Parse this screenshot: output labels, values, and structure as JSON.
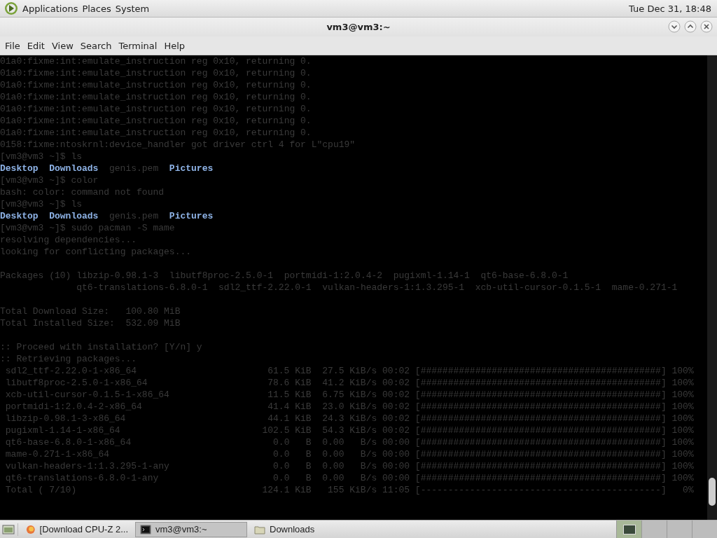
{
  "top_panel": {
    "menus": [
      {
        "label": "Applications"
      },
      {
        "label": "Places"
      },
      {
        "label": "System"
      }
    ],
    "clock": "Tue Dec 31, 18:48"
  },
  "window": {
    "title": "vm3@vm3:~"
  },
  "menu_bar": [
    {
      "label": "File"
    },
    {
      "label": "Edit"
    },
    {
      "label": "View"
    },
    {
      "label": "Search"
    },
    {
      "label": "Terminal"
    },
    {
      "label": "Help"
    }
  ],
  "terminal": {
    "lines": [
      {
        "kind": "text",
        "text": "01a0:fixme:int:emulate_instruction reg 0x10, returning 0."
      },
      {
        "kind": "text",
        "text": "01a0:fixme:int:emulate_instruction reg 0x10, returning 0."
      },
      {
        "kind": "text",
        "text": "01a0:fixme:int:emulate_instruction reg 0x10, returning 0."
      },
      {
        "kind": "text",
        "text": "01a0:fixme:int:emulate_instruction reg 0x10, returning 0."
      },
      {
        "kind": "text",
        "text": "01a0:fixme:int:emulate_instruction reg 0x10, returning 0."
      },
      {
        "kind": "text",
        "text": "01a0:fixme:int:emulate_instruction reg 0x10, returning 0."
      },
      {
        "kind": "text",
        "text": "01a0:fixme:int:emulate_instruction reg 0x10, returning 0."
      },
      {
        "kind": "text",
        "text": "0158:fixme:ntoskrnl:device_handler got driver ctrl 4 for L\"cpu19\""
      },
      {
        "kind": "text",
        "text": "[vm3@vm3 ~]$ ls"
      },
      {
        "kind": "ls",
        "entries": [
          {
            "text": "Desktop",
            "kind": "dir"
          },
          {
            "text": "Downloads",
            "kind": "dir"
          },
          {
            "text": "genis.pem",
            "kind": "file"
          },
          {
            "text": "Pictures",
            "kind": "dir"
          }
        ]
      },
      {
        "kind": "text",
        "text": "[vm3@vm3 ~]$ color"
      },
      {
        "kind": "text",
        "text": "bash: color: command not found"
      },
      {
        "kind": "text",
        "text": "[vm3@vm3 ~]$ ls"
      },
      {
        "kind": "ls",
        "entries": [
          {
            "text": "Desktop",
            "kind": "dir"
          },
          {
            "text": "Downloads",
            "kind": "dir"
          },
          {
            "text": "genis.pem",
            "kind": "file"
          },
          {
            "text": "Pictures",
            "kind": "dir"
          }
        ]
      },
      {
        "kind": "text",
        "text": "[vm3@vm3 ~]$ sudo pacman -S mame"
      },
      {
        "kind": "text",
        "text": "resolving dependencies..."
      },
      {
        "kind": "text",
        "text": "looking for conflicting packages..."
      },
      {
        "kind": "blank"
      },
      {
        "kind": "text",
        "text": "Packages (10) libzip-0.98.1-3  libutf8proc-2.5.0-1  portmidi-1:2.0.4-2  pugixml-1.14-1  qt6-base-6.8.0-1"
      },
      {
        "kind": "text",
        "text": "              qt6-translations-6.8.0-1  sdl2_ttf-2.22.0-1  vulkan-headers-1:1.3.295-1  xcb-util-cursor-0.1.5-1  mame-0.271-1"
      },
      {
        "kind": "blank"
      },
      {
        "kind": "text",
        "text": "Total Download Size:   100.80 MiB"
      },
      {
        "kind": "text",
        "text": "Total Installed Size:  532.09 MiB"
      },
      {
        "kind": "blank"
      },
      {
        "kind": "text",
        "text": ":: Proceed with installation? [Y/n] y"
      },
      {
        "kind": "text",
        "text": ":: Retrieving packages..."
      },
      {
        "kind": "download",
        "name": "sdl2_ttf-2.22.0-1-x86_64",
        "size": "61.5 KiB",
        "rate": "27.5 KiB/s",
        "time": "00:02",
        "bar": "[############################################]",
        "percent": "100%"
      },
      {
        "kind": "download",
        "name": "libutf8proc-2.5.0-1-x86_64",
        "size": "78.6 KiB",
        "rate": "41.2 KiB/s",
        "time": "00:02",
        "bar": "[############################################]",
        "percent": "100%"
      },
      {
        "kind": "download",
        "name": "xcb-util-cursor-0.1.5-1-x86_64",
        "size": "11.5 KiB",
        "rate": "6.75 KiB/s",
        "time": "00:02",
        "bar": "[############################################]",
        "percent": "100%"
      },
      {
        "kind": "download",
        "name": "portmidi-1:2.0.4-2-x86_64",
        "size": "41.4 KiB",
        "rate": "23.0 KiB/s",
        "time": "00:02",
        "bar": "[############################################]",
        "percent": "100%"
      },
      {
        "kind": "download",
        "name": "libzip-0.98.1-3-x86_64",
        "size": "44.1 KiB",
        "rate": "24.3 KiB/s",
        "time": "00:02",
        "bar": "[############################################]",
        "percent": "100%"
      },
      {
        "kind": "download",
        "name": "pugixml-1.14-1-x86_64",
        "size": "102.5 KiB",
        "rate": "54.3 KiB/s",
        "time": "00:02",
        "bar": "[############################################]",
        "percent": "100%"
      },
      {
        "kind": "download",
        "name": "qt6-base-6.8.0-1-x86_64",
        "size": "0.0   B",
        "rate": "0.00   B/s",
        "time": "00:00",
        "bar": "[############################################]",
        "percent": "100%"
      },
      {
        "kind": "download",
        "name": "mame-0.271-1-x86_64",
        "size": "0.0   B",
        "rate": "0.00   B/s",
        "time": "00:00",
        "bar": "[############################################]",
        "percent": "100%"
      },
      {
        "kind": "download",
        "name": "vulkan-headers-1:1.3.295-1-any",
        "size": "0.0   B",
        "rate": "0.00   B/s",
        "time": "00:00",
        "bar": "[############################################]",
        "percent": "100%"
      },
      {
        "kind": "download",
        "name": "qt6-translations-6.8.0-1-any",
        "size": "0.0   B",
        "rate": "0.00   B/s",
        "time": "00:00",
        "bar": "[############################################]",
        "percent": "100%"
      },
      {
        "kind": "download",
        "name": "Total ( 7/10)",
        "size": "124.1 KiB",
        "rate": "155 KiB/s",
        "time": "11:05",
        "bar": "[--------------------------------------------]",
        "percent": "0%"
      }
    ]
  },
  "taskbar": {
    "items": [
      {
        "kind": "browser",
        "label": "[Download CPU-Z 2...",
        "selected": false
      },
      {
        "kind": "terminal",
        "label": "vm3@vm3:~",
        "selected": true
      },
      {
        "kind": "folder",
        "label": "Downloads",
        "selected": false
      }
    ],
    "workspaces": [
      {
        "selected": true
      },
      {
        "selected": false
      },
      {
        "selected": false
      },
      {
        "selected": false
      }
    ]
  }
}
